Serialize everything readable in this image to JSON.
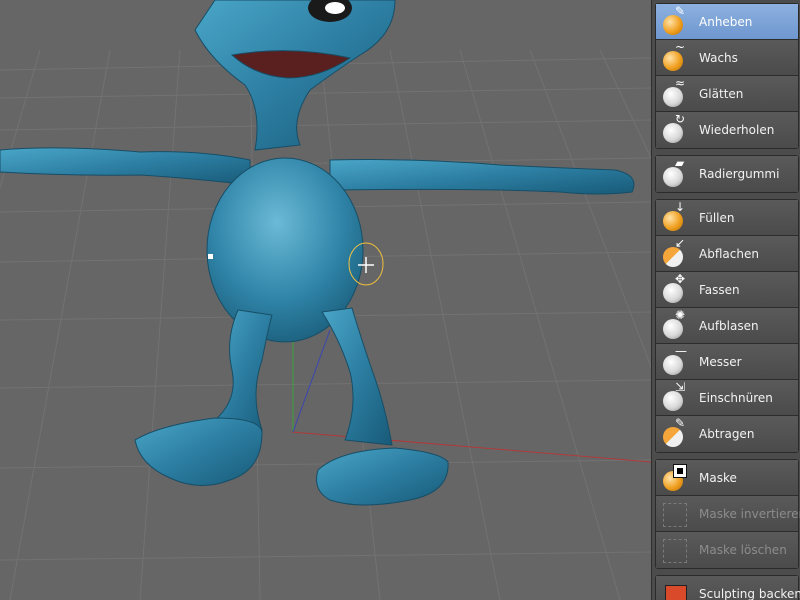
{
  "tools": {
    "brushes_primary": [
      {
        "id": "anheben",
        "label": "Anheben",
        "icon": "brush-lift-icon",
        "active": true
      },
      {
        "id": "wachs",
        "label": "Wachs",
        "icon": "brush-wax-icon",
        "active": false
      },
      {
        "id": "glaetten",
        "label": "Glätten",
        "icon": "brush-smooth-icon",
        "active": false
      },
      {
        "id": "wiederholen",
        "label": "Wiederholen",
        "icon": "brush-repeat-icon",
        "active": false
      }
    ],
    "eraser": {
      "label": "Radiergummi",
      "icon": "eraser-icon"
    },
    "brushes_secondary": [
      {
        "id": "fuellen",
        "label": "Füllen",
        "icon": "brush-fill-icon"
      },
      {
        "id": "abflachen",
        "label": "Abflachen",
        "icon": "brush-flatten-icon"
      },
      {
        "id": "fassen",
        "label": "Fassen",
        "icon": "brush-grab-icon"
      },
      {
        "id": "aufblasen",
        "label": "Aufblasen",
        "icon": "brush-inflate-icon"
      },
      {
        "id": "messer",
        "label": "Messer",
        "icon": "brush-knife-icon"
      },
      {
        "id": "einschnueren",
        "label": "Einschnüren",
        "icon": "brush-pinch-icon"
      },
      {
        "id": "abtragen",
        "label": "Abtragen",
        "icon": "brush-scrape-icon"
      }
    ],
    "mask": [
      {
        "id": "maske",
        "label": "Maske",
        "icon": "mask-icon",
        "disabled": false
      },
      {
        "id": "maske_invertieren",
        "label": "Maske invertieren",
        "icon": "mask-invert-icon",
        "disabled": true
      },
      {
        "id": "maske_loeschen",
        "label": "Maske löschen",
        "icon": "mask-clear-icon",
        "disabled": true
      }
    ],
    "bake": {
      "label": "Sculpting backen",
      "icon": "sculpt-bake-icon"
    }
  },
  "colors": {
    "viewport_bg": "#666666",
    "model": "#2f7fa3",
    "active_tool": "#7ea3d6",
    "brush_ring": "#f0c040"
  }
}
